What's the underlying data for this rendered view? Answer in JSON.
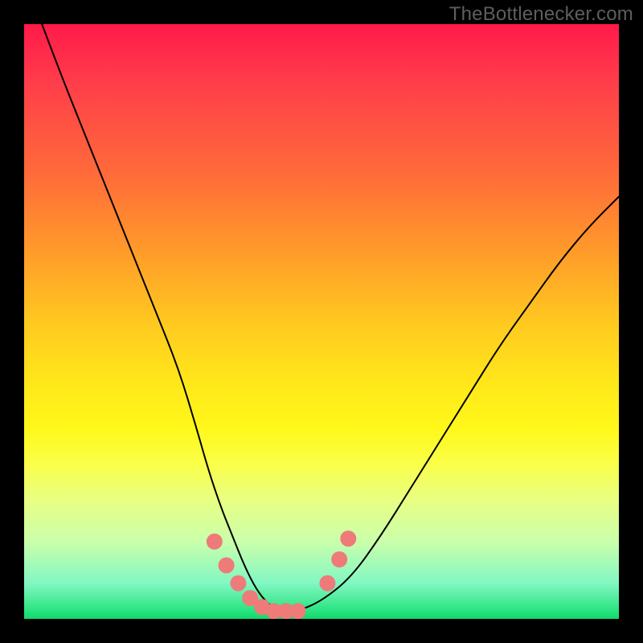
{
  "watermark": "TheBottlenecker.com",
  "chart_data": {
    "type": "line",
    "title": "",
    "xlabel": "",
    "ylabel": "",
    "xlim": [
      0,
      100
    ],
    "ylim": [
      0,
      100
    ],
    "gradient_stops": [
      {
        "pos": 0,
        "color": "#ff1a4a"
      },
      {
        "pos": 10,
        "color": "#ff3e4a"
      },
      {
        "pos": 25,
        "color": "#ff6a3a"
      },
      {
        "pos": 38,
        "color": "#ff9a2a"
      },
      {
        "pos": 50,
        "color": "#ffc820"
      },
      {
        "pos": 60,
        "color": "#ffe61a"
      },
      {
        "pos": 68,
        "color": "#fff81a"
      },
      {
        "pos": 74,
        "color": "#faff4a"
      },
      {
        "pos": 80,
        "color": "#e8ff82"
      },
      {
        "pos": 87,
        "color": "#caffab"
      },
      {
        "pos": 94,
        "color": "#82f7c2"
      },
      {
        "pos": 99,
        "color": "#22e27a"
      },
      {
        "pos": 100,
        "color": "#10d86a"
      }
    ],
    "series": [
      {
        "name": "bottleneck-curve",
        "color": "#000000",
        "stroke_width": 2,
        "x": [
          3,
          6,
          10,
          14,
          18,
          22,
          26,
          29,
          31,
          33,
          35,
          37,
          39,
          41,
          43,
          46,
          50,
          55,
          60,
          65,
          70,
          75,
          80,
          85,
          90,
          95,
          100
        ],
        "y": [
          100,
          92,
          82,
          72,
          62,
          52,
          42,
          32,
          25,
          19,
          14,
          9,
          5,
          2.5,
          1.3,
          1.3,
          3,
          7,
          14,
          22,
          30,
          38,
          46,
          53,
          60,
          66,
          71
        ]
      },
      {
        "name": "marker-dots",
        "color": "#ef7a7a",
        "radius_px": 10,
        "points": [
          {
            "x": 32,
            "y": 13
          },
          {
            "x": 34,
            "y": 9
          },
          {
            "x": 36,
            "y": 6
          },
          {
            "x": 38,
            "y": 3.5
          },
          {
            "x": 40,
            "y": 2
          },
          {
            "x": 42,
            "y": 1.3
          },
          {
            "x": 44,
            "y": 1.3
          },
          {
            "x": 46,
            "y": 1.3
          },
          {
            "x": 51,
            "y": 6
          },
          {
            "x": 53,
            "y": 10
          },
          {
            "x": 54.5,
            "y": 13.5
          }
        ]
      }
    ]
  }
}
